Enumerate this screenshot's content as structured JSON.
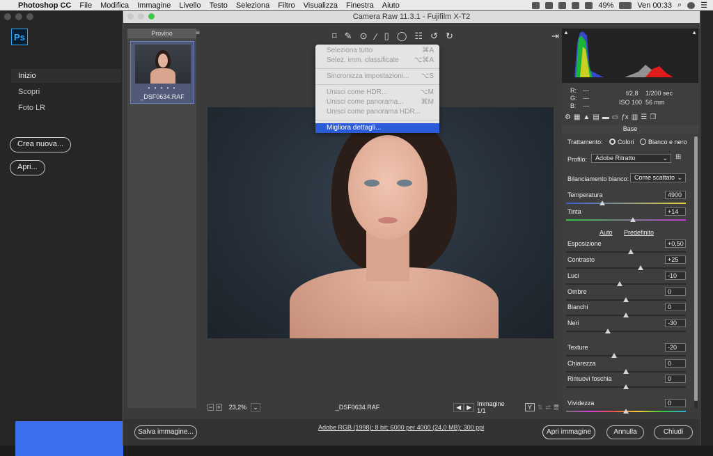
{
  "menubar": {
    "apple": "",
    "app": "Photoshop CC",
    "items": [
      "File",
      "Modifica",
      "Immagine",
      "Livello",
      "Testo",
      "Seleziona",
      "Filtro",
      "Visualizza",
      "Finestra",
      "Aiuto"
    ],
    "battery": "49%",
    "clock": "Ven 00:33"
  },
  "home": {
    "logo": "Ps",
    "nav": [
      "Inizio",
      "Scopri",
      "Foto LR"
    ],
    "new_button": "Crea nuova...",
    "open_button": "Apri..."
  },
  "camera_raw": {
    "title": "Camera Raw 11.3.1  -  Fujifilm X-T2",
    "filmstrip_label": "Provino",
    "thumb_stars": "• • • • •",
    "thumb_name": "_DSF0634.RAF",
    "menu": {
      "items": [
        {
          "label": "Seleziona tutto",
          "shortcut": "⌘A"
        },
        {
          "label": "Selez. imm. classificate",
          "shortcut": "⌥⌘A"
        },
        {
          "label": "Sincronizza impostazioni...",
          "shortcut": "⌥S"
        },
        {
          "label": "Unisci come HDR...",
          "shortcut": "⌥M"
        },
        {
          "label": "Unisci come panorama...",
          "shortcut": "⌘M"
        },
        {
          "label": "Unisci come panorama HDR...",
          "shortcut": ""
        },
        {
          "label": "Migliora dettagli...",
          "shortcut": ""
        }
      ]
    },
    "status": {
      "zoom": "23,2%",
      "filename": "_DSF0634.RAF",
      "image_count": "Immagine 1/1"
    },
    "readout": {
      "r": "R:",
      "r_val": "---",
      "g": "G:",
      "g_val": "---",
      "b": "B:",
      "b_val": "---",
      "aperture": "f/2,8",
      "shutter": "1/200 sec",
      "iso": "ISO 100",
      "focal": "56 mm"
    },
    "panel": {
      "title": "Base",
      "treatment_label": "Trattamento:",
      "treatment_color": "Colori",
      "treatment_bw": "Bianco e nero",
      "profile_label": "Profilo:",
      "profile_value": "Adobe Ritratto",
      "wb_label": "Bilanciamento bianco:",
      "wb_value": "Come scattato",
      "auto": "Auto",
      "default": "Predefinito",
      "sliders": [
        {
          "label": "Temperatura",
          "value": "4900",
          "pos": 0.3
        },
        {
          "label": "Tinta",
          "value": "+14",
          "pos": 0.56
        },
        {
          "label": "Esposizione",
          "value": "+0,50",
          "pos": 0.54
        },
        {
          "label": "Contrasto",
          "value": "+25",
          "pos": 0.62
        },
        {
          "label": "Luci",
          "value": "-10",
          "pos": 0.45
        },
        {
          "label": "Ombre",
          "value": "0",
          "pos": 0.5
        },
        {
          "label": "Bianchi",
          "value": "0",
          "pos": 0.5
        },
        {
          "label": "Neri",
          "value": "-30",
          "pos": 0.35
        },
        {
          "label": "Texture",
          "value": "-20",
          "pos": 0.4
        },
        {
          "label": "Chiarezza",
          "value": "0",
          "pos": 0.5
        },
        {
          "label": "Rimuovi foschia",
          "value": "0",
          "pos": 0.5
        },
        {
          "label": "Vividezza",
          "value": "0",
          "pos": 0.5
        }
      ]
    },
    "bottom": {
      "save": "Salva immagine...",
      "file_info": "Adobe RGB (1998); 8 bit; 6000 per 4000 (24,0 MB); 300 ppi",
      "open": "Apri immagine",
      "cancel": "Annulla",
      "done": "Chiudi"
    }
  },
  "colors": {
    "ps_blue": "#31a8ff",
    "highlight": "#2b5bd7",
    "start_bar": "#3c6ff0"
  }
}
